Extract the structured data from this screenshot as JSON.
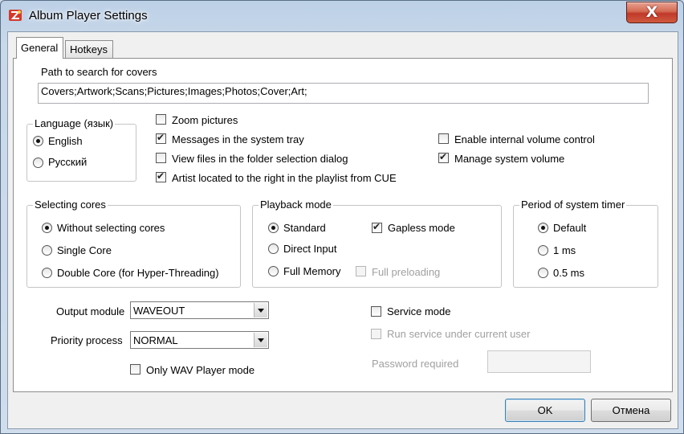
{
  "window": {
    "title": "Album Player Settings",
    "close_symbol": "X"
  },
  "tabs": [
    {
      "label": "General"
    },
    {
      "label": "Hotkeys"
    }
  ],
  "covers": {
    "label": "Path to search for covers",
    "value": "Covers;Artwork;Scans;Pictures;Images;Photos;Cover;Art;"
  },
  "language": {
    "title": "Language (язык)",
    "options": [
      {
        "label": "English",
        "checked": true
      },
      {
        "label": "Русский",
        "checked": false
      }
    ]
  },
  "options_col1": [
    {
      "label": "Zoom pictures",
      "checked": false
    },
    {
      "label": "Messages in the system tray",
      "checked": true
    },
    {
      "label": "View files in the folder selection dialog",
      "checked": false
    },
    {
      "label": "Artist located to the right in the playlist from CUE",
      "checked": true
    }
  ],
  "options_col2": [
    {
      "label": "Enable internal volume control",
      "checked": false
    },
    {
      "label": "Manage system volume",
      "checked": true
    }
  ],
  "cores": {
    "title": "Selecting cores",
    "options": [
      {
        "label": "Without selecting cores",
        "checked": true
      },
      {
        "label": "Single Core",
        "checked": false
      },
      {
        "label": "Double Core (for Hyper-Threading)",
        "checked": false
      }
    ]
  },
  "playback": {
    "title": "Playback mode",
    "options": [
      {
        "label": "Standard",
        "checked": true
      },
      {
        "label": "Direct Input",
        "checked": false
      },
      {
        "label": "Full Memory",
        "checked": false
      }
    ],
    "gapless": {
      "label": "Gapless mode",
      "checked": true
    },
    "full_preloading": {
      "label": "Full preloading",
      "checked": false,
      "enabled": false
    }
  },
  "timer": {
    "title": "Period of system timer",
    "options": [
      {
        "label": "Default",
        "checked": true
      },
      {
        "label": "1 ms",
        "checked": false
      },
      {
        "label": "0.5 ms",
        "checked": false
      }
    ]
  },
  "output_module": {
    "label": "Output module",
    "value": "WAVEOUT"
  },
  "priority": {
    "label": "Priority process",
    "value": "NORMAL"
  },
  "only_wav": {
    "label": "Only WAV Player mode",
    "checked": false
  },
  "service": {
    "mode": {
      "label": "Service mode",
      "checked": false
    },
    "run_as_user": {
      "label": "Run service under current user",
      "checked": false,
      "enabled": false
    },
    "password": {
      "label": "Password required",
      "value": "",
      "enabled": false
    }
  },
  "buttons": {
    "ok": "OK",
    "cancel": "Отмена"
  },
  "colors": {
    "close_button": "#c0392b",
    "window_frame": "#cfdcec",
    "disabled_text": "#a0a0a0"
  }
}
